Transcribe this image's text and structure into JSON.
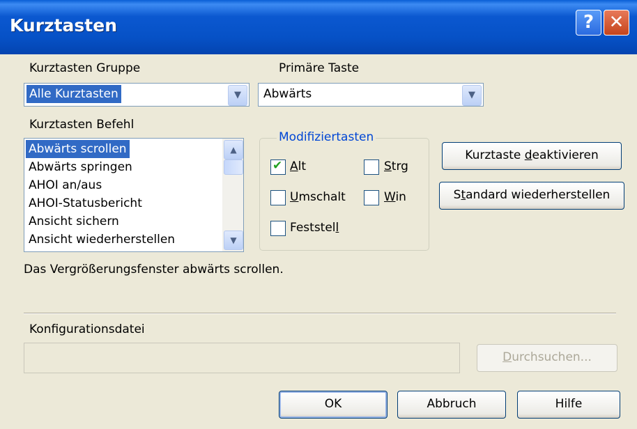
{
  "window": {
    "title": "Kurztasten"
  },
  "titlebar": {
    "help_label": "?",
    "close_label": "✕"
  },
  "group": {
    "label": "Kurztasten Gruppe",
    "value": "Alle Kurztasten"
  },
  "primary_key": {
    "label": "Primäre Taste",
    "value": "Abwärts"
  },
  "command": {
    "label": "Kurztasten Befehl",
    "items": [
      "Abwärts scrollen",
      "Abwärts springen",
      "AHOI an/aus",
      "AHOI-Statusbericht",
      "Ansicht sichern",
      "Ansicht wiederherstellen"
    ],
    "selected_index": 0
  },
  "modifiers": {
    "legend": "Modifiziertasten",
    "alt": {
      "pre": "",
      "mn": "A",
      "post": "lt",
      "checked": true
    },
    "strg": {
      "pre": "",
      "mn": "S",
      "post": "trg",
      "checked": false
    },
    "umschalt": {
      "pre": "",
      "mn": "U",
      "post": "mschalt",
      "checked": false
    },
    "win": {
      "pre": "",
      "mn": "W",
      "post": "in",
      "checked": false
    },
    "feststell": {
      "pre": "Feststel",
      "mn": "l",
      "post": "",
      "checked": false
    }
  },
  "buttons": {
    "deactivate": {
      "pre": "Kurztaste ",
      "mn": "d",
      "post": "eaktivieren"
    },
    "restore": {
      "pre": "S",
      "mn": "t",
      "post": "andard wiederherstellen"
    },
    "browse": {
      "pre": "",
      "mn": "D",
      "post": "urchsuchen..."
    },
    "ok": "OK",
    "cancel": "Abbruch",
    "help": "Hilfe"
  },
  "description": "Das Vergrößerungsfenster abwärts scrollen.",
  "config": {
    "label": "Konfigurationsdatei",
    "value": ""
  },
  "icons": {
    "dropdown": "chevron-down-icon",
    "scroll_up": "arrow-up-icon",
    "scroll_down": "arrow-down-icon",
    "check": "checkmark-icon"
  },
  "colors": {
    "title_bar": "#0a58d0",
    "selection": "#316ac5",
    "group_legend": "#0046d5",
    "check": "#21a121"
  }
}
